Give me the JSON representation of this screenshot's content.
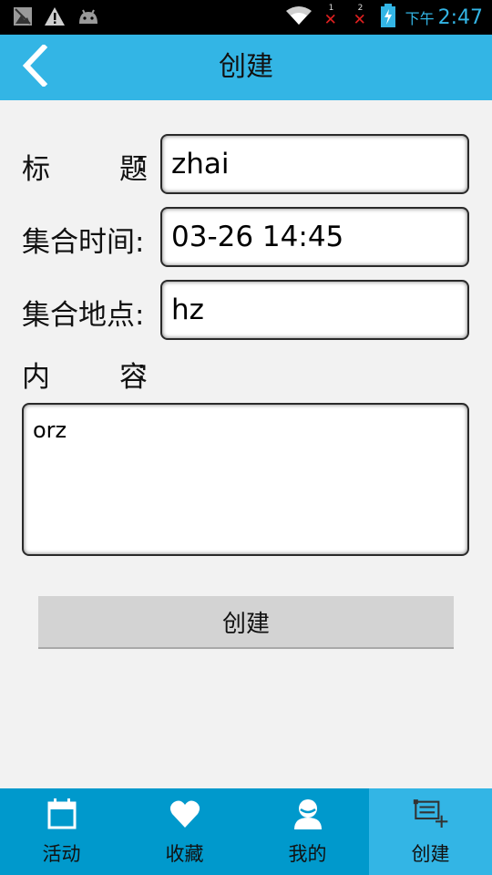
{
  "status_bar": {
    "ampm": "下午",
    "time": "2:47",
    "sim1_label": "1",
    "sim2_label": "2",
    "sim_error_mark": "✕"
  },
  "title_bar": {
    "title": "创建",
    "back_icon": "chevron-left-icon"
  },
  "form": {
    "title_label_chars": [
      "标",
      "题"
    ],
    "time_label": "集合时间",
    "place_label": "集合地点",
    "content_label_chars": [
      "内",
      "容"
    ],
    "colon": ":",
    "title_value": "zhai",
    "time_value": "03-26 14:45",
    "place_value": "hz",
    "content_value": "orz",
    "submit_label": "创建"
  },
  "bottom_nav": {
    "active_index": 3,
    "items": [
      {
        "label": "活动",
        "icon": "calendar-icon"
      },
      {
        "label": "收藏",
        "icon": "heart-icon"
      },
      {
        "label": "我的",
        "icon": "person-icon"
      },
      {
        "label": "创建",
        "icon": "create-post-icon"
      }
    ]
  },
  "colors": {
    "accent": "#33b5e5",
    "nav_background": "#0099cc",
    "page_background": "#f2f2f2",
    "button_background": "#d3d3d3"
  }
}
